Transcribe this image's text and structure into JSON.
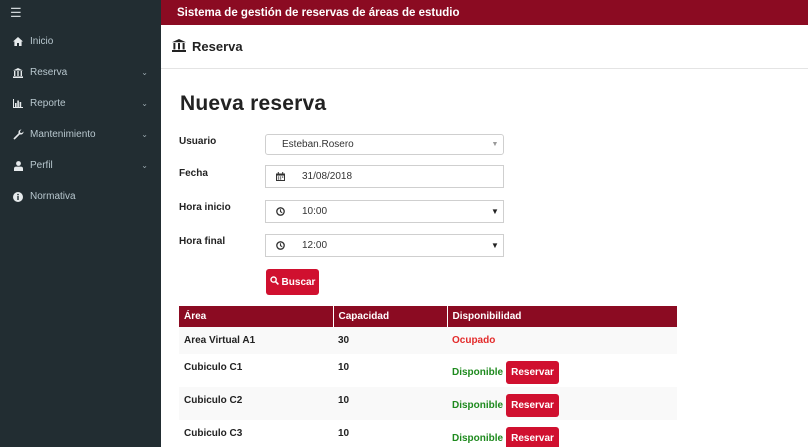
{
  "app": {
    "title": "Sistema de gestión de reservas de áreas de estudio",
    "accent": "#8b0b22",
    "button_color": "#d0102f"
  },
  "sidebar": {
    "items": [
      {
        "label": "Inicio",
        "icon": "home-icon",
        "expandable": false
      },
      {
        "label": "Reserva",
        "icon": "bank-icon",
        "expandable": true
      },
      {
        "label": "Reporte",
        "icon": "bar-chart-icon",
        "expandable": true
      },
      {
        "label": "Mantenimiento",
        "icon": "wrench-icon",
        "expandable": true
      },
      {
        "label": "Perfil",
        "icon": "user-icon",
        "expandable": true
      },
      {
        "label": "Normativa",
        "icon": "info-circle-icon",
        "expandable": false
      }
    ]
  },
  "page": {
    "section_title": "Reserva",
    "heading": "Nueva reserva"
  },
  "form": {
    "usuario_label": "Usuario",
    "usuario_value": "Esteban.Rosero",
    "fecha_label": "Fecha",
    "fecha_value": "31/08/2018",
    "hora_inicio_label": "Hora inicio",
    "hora_inicio_value": "10:00",
    "hora_final_label": "Hora final",
    "hora_final_value": "12:00",
    "buscar_label": "Buscar"
  },
  "table": {
    "headers": [
      "Área",
      "Capacidad",
      "Disponibilidad"
    ],
    "rows": [
      {
        "area": "Area Virtual A1",
        "capacidad": "30",
        "estado": "Ocupado",
        "action": ""
      },
      {
        "area": "Cubiculo C1",
        "capacidad": "10",
        "estado": "Disponible",
        "action": "Reservar"
      },
      {
        "area": "Cubiculo C2",
        "capacidad": "10",
        "estado": "Disponible",
        "action": "Reservar"
      },
      {
        "area": "Cubiculo C3",
        "capacidad": "10",
        "estado": "Disponible",
        "action": "Reservar"
      }
    ],
    "status_colors": {
      "ocupado": "#e32b2b",
      "disponible": "#1e8a1e"
    }
  }
}
